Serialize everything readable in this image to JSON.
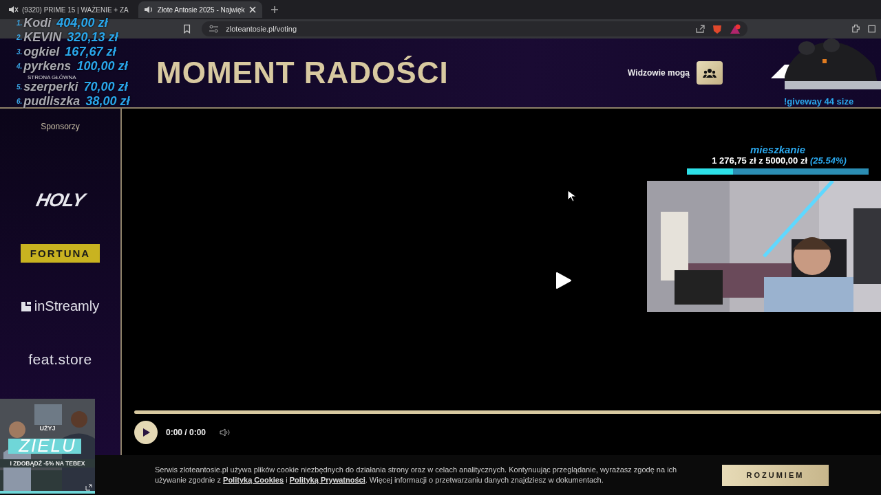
{
  "browser": {
    "tabs": [
      {
        "title": "(9320) PRIME 15 | WAŻENIE + ZA",
        "selected": false,
        "muted": true
      },
      {
        "title": "Złote Antosie 2025 - Najwięk",
        "selected": true,
        "muted": false
      }
    ],
    "url": "zloteantosie.pl/voting"
  },
  "header": {
    "title": "MOMENT RADOŚCI",
    "nav_link": "STRONA GŁÓWNA",
    "viewers_label": "Widzowie mogą"
  },
  "sidebar": {
    "heading": "Sponsorzy",
    "sponsors": [
      {
        "name": "HOLY",
        "kind": "holy"
      },
      {
        "name": "FORTUNA",
        "kind": "fortuna"
      },
      {
        "name": "inStreamly",
        "kind": "instreamly"
      },
      {
        "name": "feat.store",
        "kind": "featstore"
      }
    ]
  },
  "player": {
    "time": "0:00 / 0:00",
    "level": 0
  },
  "cookie_banner": {
    "text_before": "Serwis zloteantosie.pl używa plików cookie niezbędnych do działania strony oraz w celach analitycznych. Kontynuując przeglądanie, wyrażasz zgodę na ich używanie zgodnie z ",
    "link_cookies": "Polityką Cookies",
    "joiner": " i ",
    "link_privacy": "Polityką Prywatności",
    "text_after": ". Więcej informacji o przetwarzaniu danych znajdziesz w dokumentach.",
    "button": "ROZUMIEM"
  },
  "stream_overlay": {
    "leaderboard": [
      {
        "rank": "1.",
        "name": "Kodi",
        "amount": "404,00 zł"
      },
      {
        "rank": "2.",
        "name": "KEVIN",
        "amount": "320,13 zł"
      },
      {
        "rank": "3.",
        "name": "ogkiel",
        "amount": "167,67 zł"
      },
      {
        "rank": "4.",
        "name": "pyrkens",
        "amount": "100,00 zł"
      },
      {
        "rank": "5.",
        "name": "szerperki",
        "amount": "70,00 zł"
      },
      {
        "rank": "6.",
        "name": "pudliszka",
        "amount": "38,00 zł"
      }
    ],
    "goal": {
      "title": "mieszkanie",
      "amount": "1 276,75 zł z 5000,00 zł",
      "percent": "(25.54%)",
      "level": 0.2554
    },
    "giveaway": "!giveway 44 size",
    "ad": {
      "line1": "UŻYJ",
      "code": "ZIELU",
      "line2": "I ZDOBĄDŹ -5% NA TEBEX"
    }
  }
}
